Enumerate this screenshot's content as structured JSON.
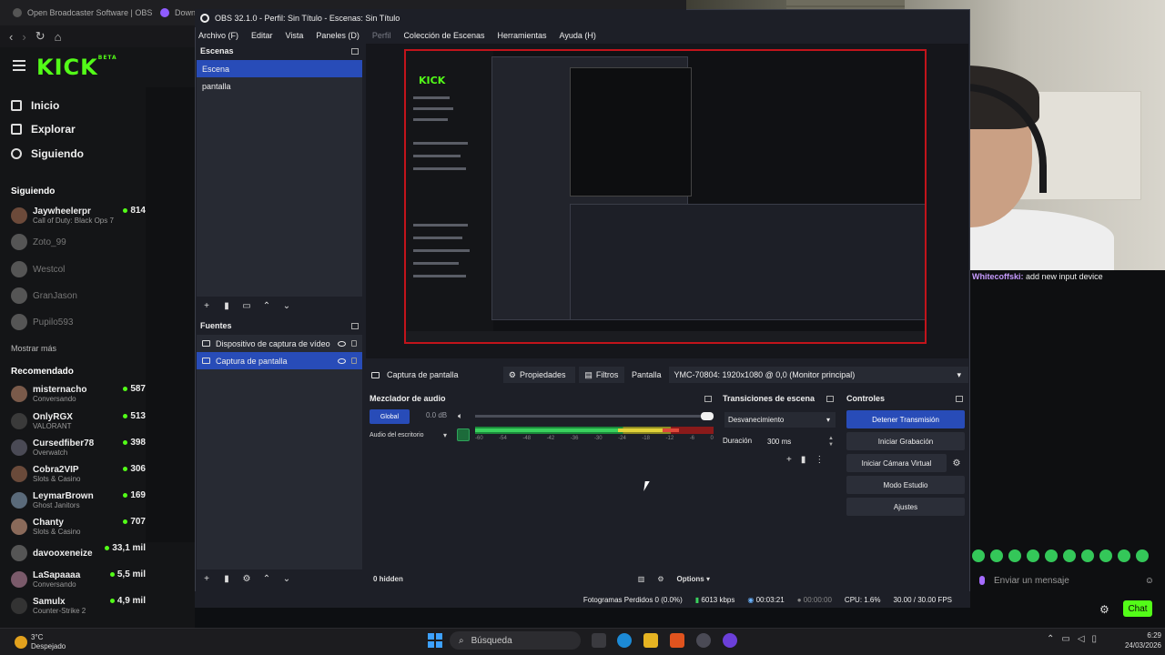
{
  "browser": {
    "tabs": [
      {
        "label": "Open Broadcaster Software | OBS"
      },
      {
        "label": "Downl"
      }
    ]
  },
  "kick": {
    "logo": "KICK",
    "logo_badge": "BETA",
    "nav": [
      {
        "label": "Inicio",
        "icon": "home-icon"
      },
      {
        "label": "Explorar",
        "icon": "compass-icon"
      },
      {
        "label": "Siguiendo",
        "icon": "heart-icon"
      }
    ],
    "following_header": "Siguiendo",
    "following": [
      {
        "name": "Jaywheelerpr",
        "game": "Call of Duty: Black Ops 7",
        "viewers": "814",
        "live": true
      },
      {
        "name": "Zoto_99",
        "game": "",
        "viewers": "",
        "live": false
      },
      {
        "name": "Westcol",
        "game": "",
        "viewers": "",
        "live": false
      },
      {
        "name": "GranJason",
        "game": "",
        "viewers": "",
        "live": false
      },
      {
        "name": "Pupilo593",
        "game": "",
        "viewers": "",
        "live": false
      }
    ],
    "show_more": "Mostrar más",
    "recommended_header": "Recomendado",
    "recommended": [
      {
        "name": "misternacho",
        "game": "Conversando",
        "viewers": "587"
      },
      {
        "name": "OnlyRGX",
        "game": "VALORANT",
        "viewers": "513"
      },
      {
        "name": "Cursedfiber78",
        "game": "Overwatch",
        "viewers": "398"
      },
      {
        "name": "Cobra2VIP",
        "game": "Slots & Casino",
        "viewers": "306"
      },
      {
        "name": "LeymarBrown",
        "game": "Ghost Janitors",
        "viewers": "169"
      },
      {
        "name": "Chanty",
        "game": "Slots & Casino",
        "viewers": "707"
      },
      {
        "name": "davooxeneize",
        "game": "",
        "viewers": "33,1 mil"
      },
      {
        "name": "LaSapaaaa",
        "game": "Conversando",
        "viewers": "5,5 mil"
      },
      {
        "name": "Samulx",
        "game": "Counter-Strike 2",
        "viewers": "4,9 mil"
      }
    ]
  },
  "obs": {
    "title": "OBS 32.1.0 - Perfil: Sin Título - Escenas: Sin Título",
    "menu": [
      {
        "label": "Archivo (F)",
        "disabled": false
      },
      {
        "label": "Editar",
        "disabled": false
      },
      {
        "label": "Vista",
        "disabled": false
      },
      {
        "label": "Paneles (D)",
        "disabled": false
      },
      {
        "label": "Perfil",
        "disabled": true
      },
      {
        "label": "Colección de Escenas",
        "disabled": false
      },
      {
        "label": "Herramientas",
        "disabled": false
      },
      {
        "label": "Ayuda (H)",
        "disabled": false
      }
    ],
    "scenes": {
      "title": "Escenas",
      "items": [
        {
          "label": "Escena",
          "selected": true
        },
        {
          "label": "pantalla",
          "selected": false
        }
      ]
    },
    "sources": {
      "title": "Fuentes",
      "items": [
        {
          "label": "Dispositivo de captura de vídeo",
          "selected": false,
          "icon": "camera-icon"
        },
        {
          "label": "Captura de pantalla",
          "selected": true,
          "icon": "monitor-icon"
        }
      ]
    },
    "context_bar": {
      "source_label": "Captura de pantalla",
      "properties_label": "Propiedades",
      "filters_label": "Filtros",
      "display_label": "Pantalla",
      "display_value": "YMC-70804: 1920x1080 @ 0,0 (Monitor principal)"
    },
    "mixer": {
      "title": "Mezclador de audio",
      "global_label": "Global",
      "db": "0.0 dB",
      "device_label": "Audio del escritorio",
      "volume_level": 1.0,
      "ticks": [
        "-60",
        "-54",
        "-48",
        "-42",
        "-36",
        "-30",
        "-24",
        "-18",
        "-12",
        "-6",
        "0"
      ],
      "hidden_label": "0 hidden",
      "options_label": "Options"
    },
    "transitions": {
      "title": "Transiciones de escena",
      "selected": "Desvanecimiento",
      "duration_label": "Duración",
      "duration_value": "300 ms"
    },
    "controls": {
      "title": "Controles",
      "buttons": [
        {
          "label": "Detener Transmisión",
          "primary": true
        },
        {
          "label": "Iniciar Grabación",
          "primary": false
        },
        {
          "label": "Iniciar Cámara Virtual",
          "primary": false
        },
        {
          "label": "Modo Estudio",
          "primary": false
        },
        {
          "label": "Ajustes",
          "primary": false
        }
      ]
    },
    "status": {
      "dropped": "Fotogramas Perdidos 0 (0.0%)",
      "bitrate": "6013 kbps",
      "stream_time": "00:03:21",
      "rec_time": "00:00:00",
      "cpu": "CPU: 1.6%",
      "fps": "30.00 / 30.00 FPS"
    }
  },
  "chat": {
    "message_user": "Whitecoffski:",
    "message_text": " add new input device",
    "input_placeholder": "Enviar un mensaje",
    "send_label": "Chat"
  },
  "taskbar": {
    "weather_temp": "3°C",
    "weather_desc": "Despejado",
    "search_label": "Búsqueda",
    "time": "6:29",
    "date": "24/03/2026"
  },
  "colors": {
    "kick_green": "#53fc18",
    "obs_accent": "#284cb8",
    "live_border": "#c2141b"
  }
}
